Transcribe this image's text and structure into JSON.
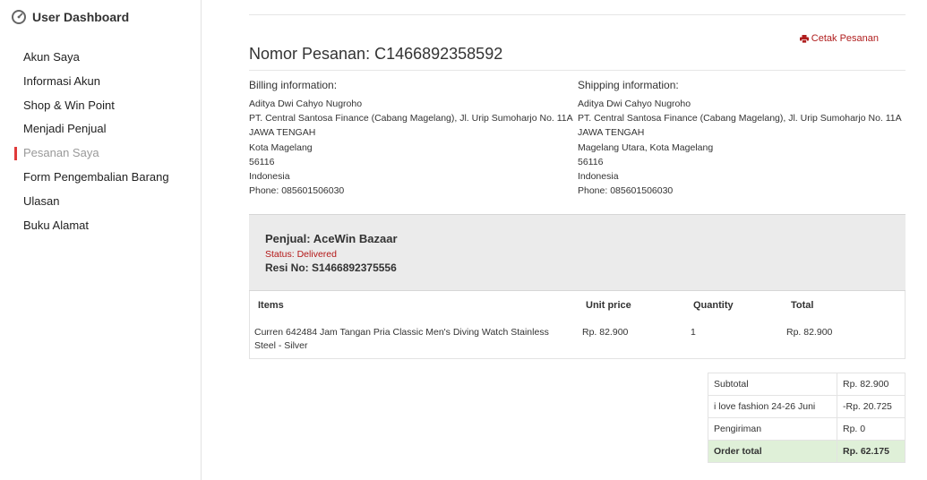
{
  "sidebar": {
    "title": "User Dashboard",
    "items": [
      {
        "label": "Akun Saya"
      },
      {
        "label": "Informasi Akun"
      },
      {
        "label": "Shop & Win Point"
      },
      {
        "label": "Menjadi Penjual"
      },
      {
        "label": "Pesanan Saya"
      },
      {
        "label": "Form Pengembalian Barang"
      },
      {
        "label": "Ulasan"
      },
      {
        "label": "Buku Alamat"
      }
    ],
    "active_index": 4
  },
  "order": {
    "print_label": "Cetak Pesanan",
    "number_label": "Nomor Pesanan: C1466892358592"
  },
  "billing": {
    "heading": "Billing information:",
    "lines": [
      "Aditya Dwi Cahyo Nugroho",
      "PT. Central Santosa Finance (Cabang Magelang), Jl. Urip Sumoharjo No. 11A",
      "JAWA TENGAH",
      "Kota Magelang",
      "56116",
      "Indonesia",
      "Phone: 085601506030"
    ]
  },
  "shipping": {
    "heading": "Shipping information:",
    "lines": [
      "Aditya Dwi Cahyo Nugroho",
      "PT. Central Santosa Finance (Cabang Magelang), Jl. Urip Sumoharjo No. 11A",
      "JAWA TENGAH",
      "Magelang Utara, Kota Magelang",
      "56116",
      "Indonesia",
      "Phone: 085601506030"
    ]
  },
  "seller": {
    "name": "Penjual: AceWin Bazaar",
    "status": "Status: Delivered",
    "resi": "Resi No: S1466892375556"
  },
  "items_table": {
    "headers": [
      "Items",
      "Unit price",
      "Quantity",
      "Total"
    ],
    "rows": [
      {
        "name_line1": "Curren 642484 Jam Tangan Pria Classic Men's Diving Watch Stainless",
        "name_line2": "Steel - Silver",
        "unit_price": "Rp. 82.900",
        "quantity": "1",
        "total": "Rp. 82.900"
      }
    ]
  },
  "totals": [
    {
      "label": "Subtotal",
      "value": "Rp. 82.900"
    },
    {
      "label": "i love fashion 24-26 Juni",
      "value": "-Rp. 20.725"
    },
    {
      "label": "Pengiriman",
      "value": "Rp. 0"
    },
    {
      "label": "Order total",
      "value": "Rp. 62.175"
    }
  ],
  "colors": {
    "accent_red": "#b01e1e",
    "active_marker": "#e03a3a",
    "grand_total_bg": "#dff0d8",
    "seller_box_bg": "#ebebeb"
  }
}
